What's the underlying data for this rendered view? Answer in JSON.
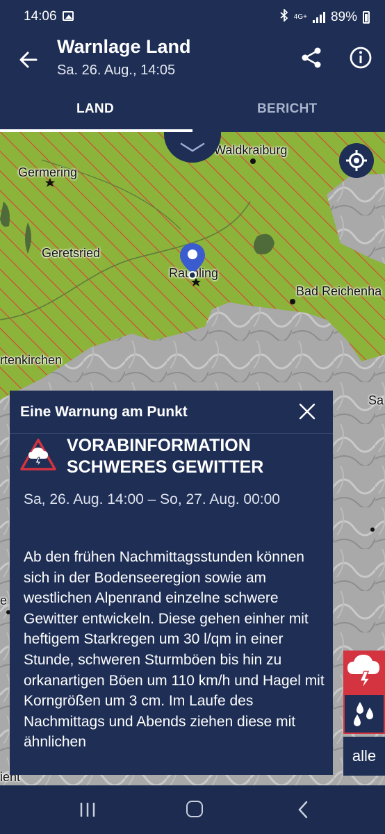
{
  "status_bar": {
    "time": "14:06",
    "network": "4G+",
    "battery": "89%",
    "icons": [
      "gallery-icon",
      "bluetooth-icon",
      "network-icon",
      "signal-icon",
      "battery-icon"
    ]
  },
  "header": {
    "title": "Warnlage Land",
    "subtitle": "Sa. 26. Aug., 14:05",
    "icons": [
      "back-arrow-icon",
      "share-icon",
      "info-icon"
    ]
  },
  "tabs": [
    {
      "label": "LAND",
      "selected": true
    },
    {
      "label": "BERICHT",
      "selected": false
    }
  ],
  "map": {
    "places": {
      "waldkraiburg": "Waldkraiburg",
      "germering": "Germering",
      "geretsried": "Geretsried",
      "raubling": "Raubling",
      "bad_reichenhall": "Bad Reichenha",
      "partenkirchen": "rtenkirchen",
      "salzburg": "Sa",
      "edge_e": "e",
      "edge_ient": "ient"
    },
    "warning_fill_color": "#8cb33a",
    "hatch_color": "#e03a3a",
    "layer_buttons": {
      "thunderstorm_icon": "thunderstorm-icon",
      "rain_icon": "rain-drops-icon",
      "all_label": "alle"
    }
  },
  "warning_card": {
    "heading": "Eine Warnung am Punkt",
    "title": "VORABINFORMATION SCHWERES GEWITTER",
    "period": "Sa, 26. Aug. 14:00 – So, 27. Aug. 00:00",
    "description": "Ab den frühen Nachmittagsstunden können sich in der Bodenseeregion sowie am westlichen Alpenrand einzelne schwere Gewitter entwickeln. Diese gehen einher mit heftigem Starkregen um 30 l/qm in einer Stunde, schweren Sturmböen bis hin zu orkanartigen Böen um 110 km/h und Hagel mit Korngrößen um 3 cm. Im Laufe des Nachmittags und Abends ziehen diese mit ähnlichen",
    "accent_color": "#d43340"
  },
  "nav_bar": {
    "buttons": [
      "recent-apps-icon",
      "home-icon",
      "back-icon"
    ]
  }
}
